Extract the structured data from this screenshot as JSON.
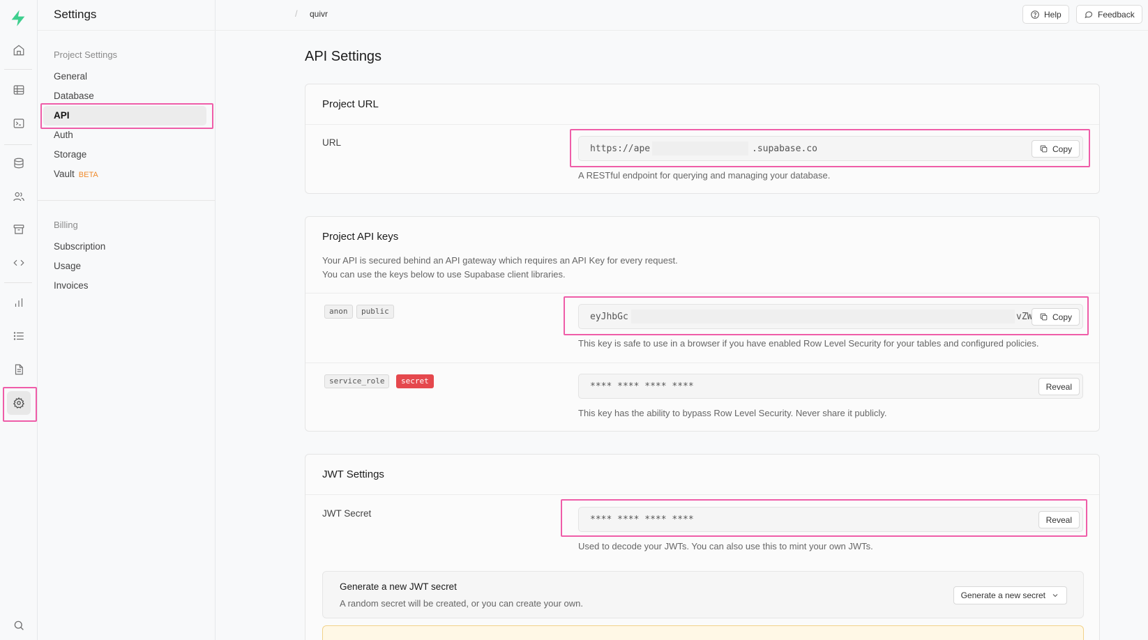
{
  "colors": {
    "accent": "#3ecf8e",
    "highlight": "#ef5da8",
    "secret_badge": "#e5484d",
    "beta": "#f08a2b"
  },
  "rail": {
    "icons": [
      "supabase-logo",
      "home-icon",
      "table-editor-icon",
      "sql-editor-icon",
      "database-icon",
      "users-icon",
      "storage-icon",
      "api-icon",
      "reports-icon",
      "logs-icon",
      "docs-icon",
      "settings-icon",
      "search-icon"
    ]
  },
  "sidebar": {
    "title": "Settings",
    "groups": [
      {
        "title": "Project Settings",
        "items": [
          {
            "label": "General"
          },
          {
            "label": "Database"
          },
          {
            "label": "API"
          },
          {
            "label": "Auth"
          },
          {
            "label": "Storage"
          },
          {
            "label": "Vault",
            "badge": "BETA"
          }
        ]
      },
      {
        "title": "Billing",
        "items": [
          {
            "label": "Subscription"
          },
          {
            "label": "Usage"
          },
          {
            "label": "Invoices"
          }
        ]
      }
    ]
  },
  "topbar": {
    "separator": "/",
    "project": "quivr",
    "help": "Help",
    "feedback": "Feedback"
  },
  "main": {
    "title": "API Settings",
    "project_url": {
      "title": "Project URL",
      "label": "URL",
      "value_start": "https://ape",
      "value_end": ".supabase.co",
      "copy": "Copy",
      "desc": "A RESTful endpoint for querying and managing your database."
    },
    "api_keys": {
      "title": "Project API keys",
      "desc1": "Your API is secured behind an API gateway which requires an API Key for every request.",
      "desc2": "You can use the keys below to use Supabase client libraries.",
      "anon": {
        "tags": [
          "anon",
          "public"
        ],
        "value_start": "eyJhbGc",
        "value_end": "vZW",
        "copy": "Copy",
        "desc": "This key is safe to use in a browser if you have enabled Row Level Security for your tables and configured policies."
      },
      "service": {
        "tags": [
          "service_role",
          "secret"
        ],
        "masked": "**** **** **** ****",
        "reveal": "Reveal",
        "desc": "This key has the ability to bypass Row Level Security. Never share it publicly."
      }
    },
    "jwt": {
      "title": "JWT Settings",
      "label": "JWT Secret",
      "masked": "**** **** **** ****",
      "reveal": "Reveal",
      "desc": "Used to decode your JWTs. You can also use this to mint your own JWTs.",
      "gen_title": "Generate a new JWT secret",
      "gen_sub": "A random secret will be created, or you can create your own.",
      "gen_btn": "Generate a new secret"
    }
  }
}
